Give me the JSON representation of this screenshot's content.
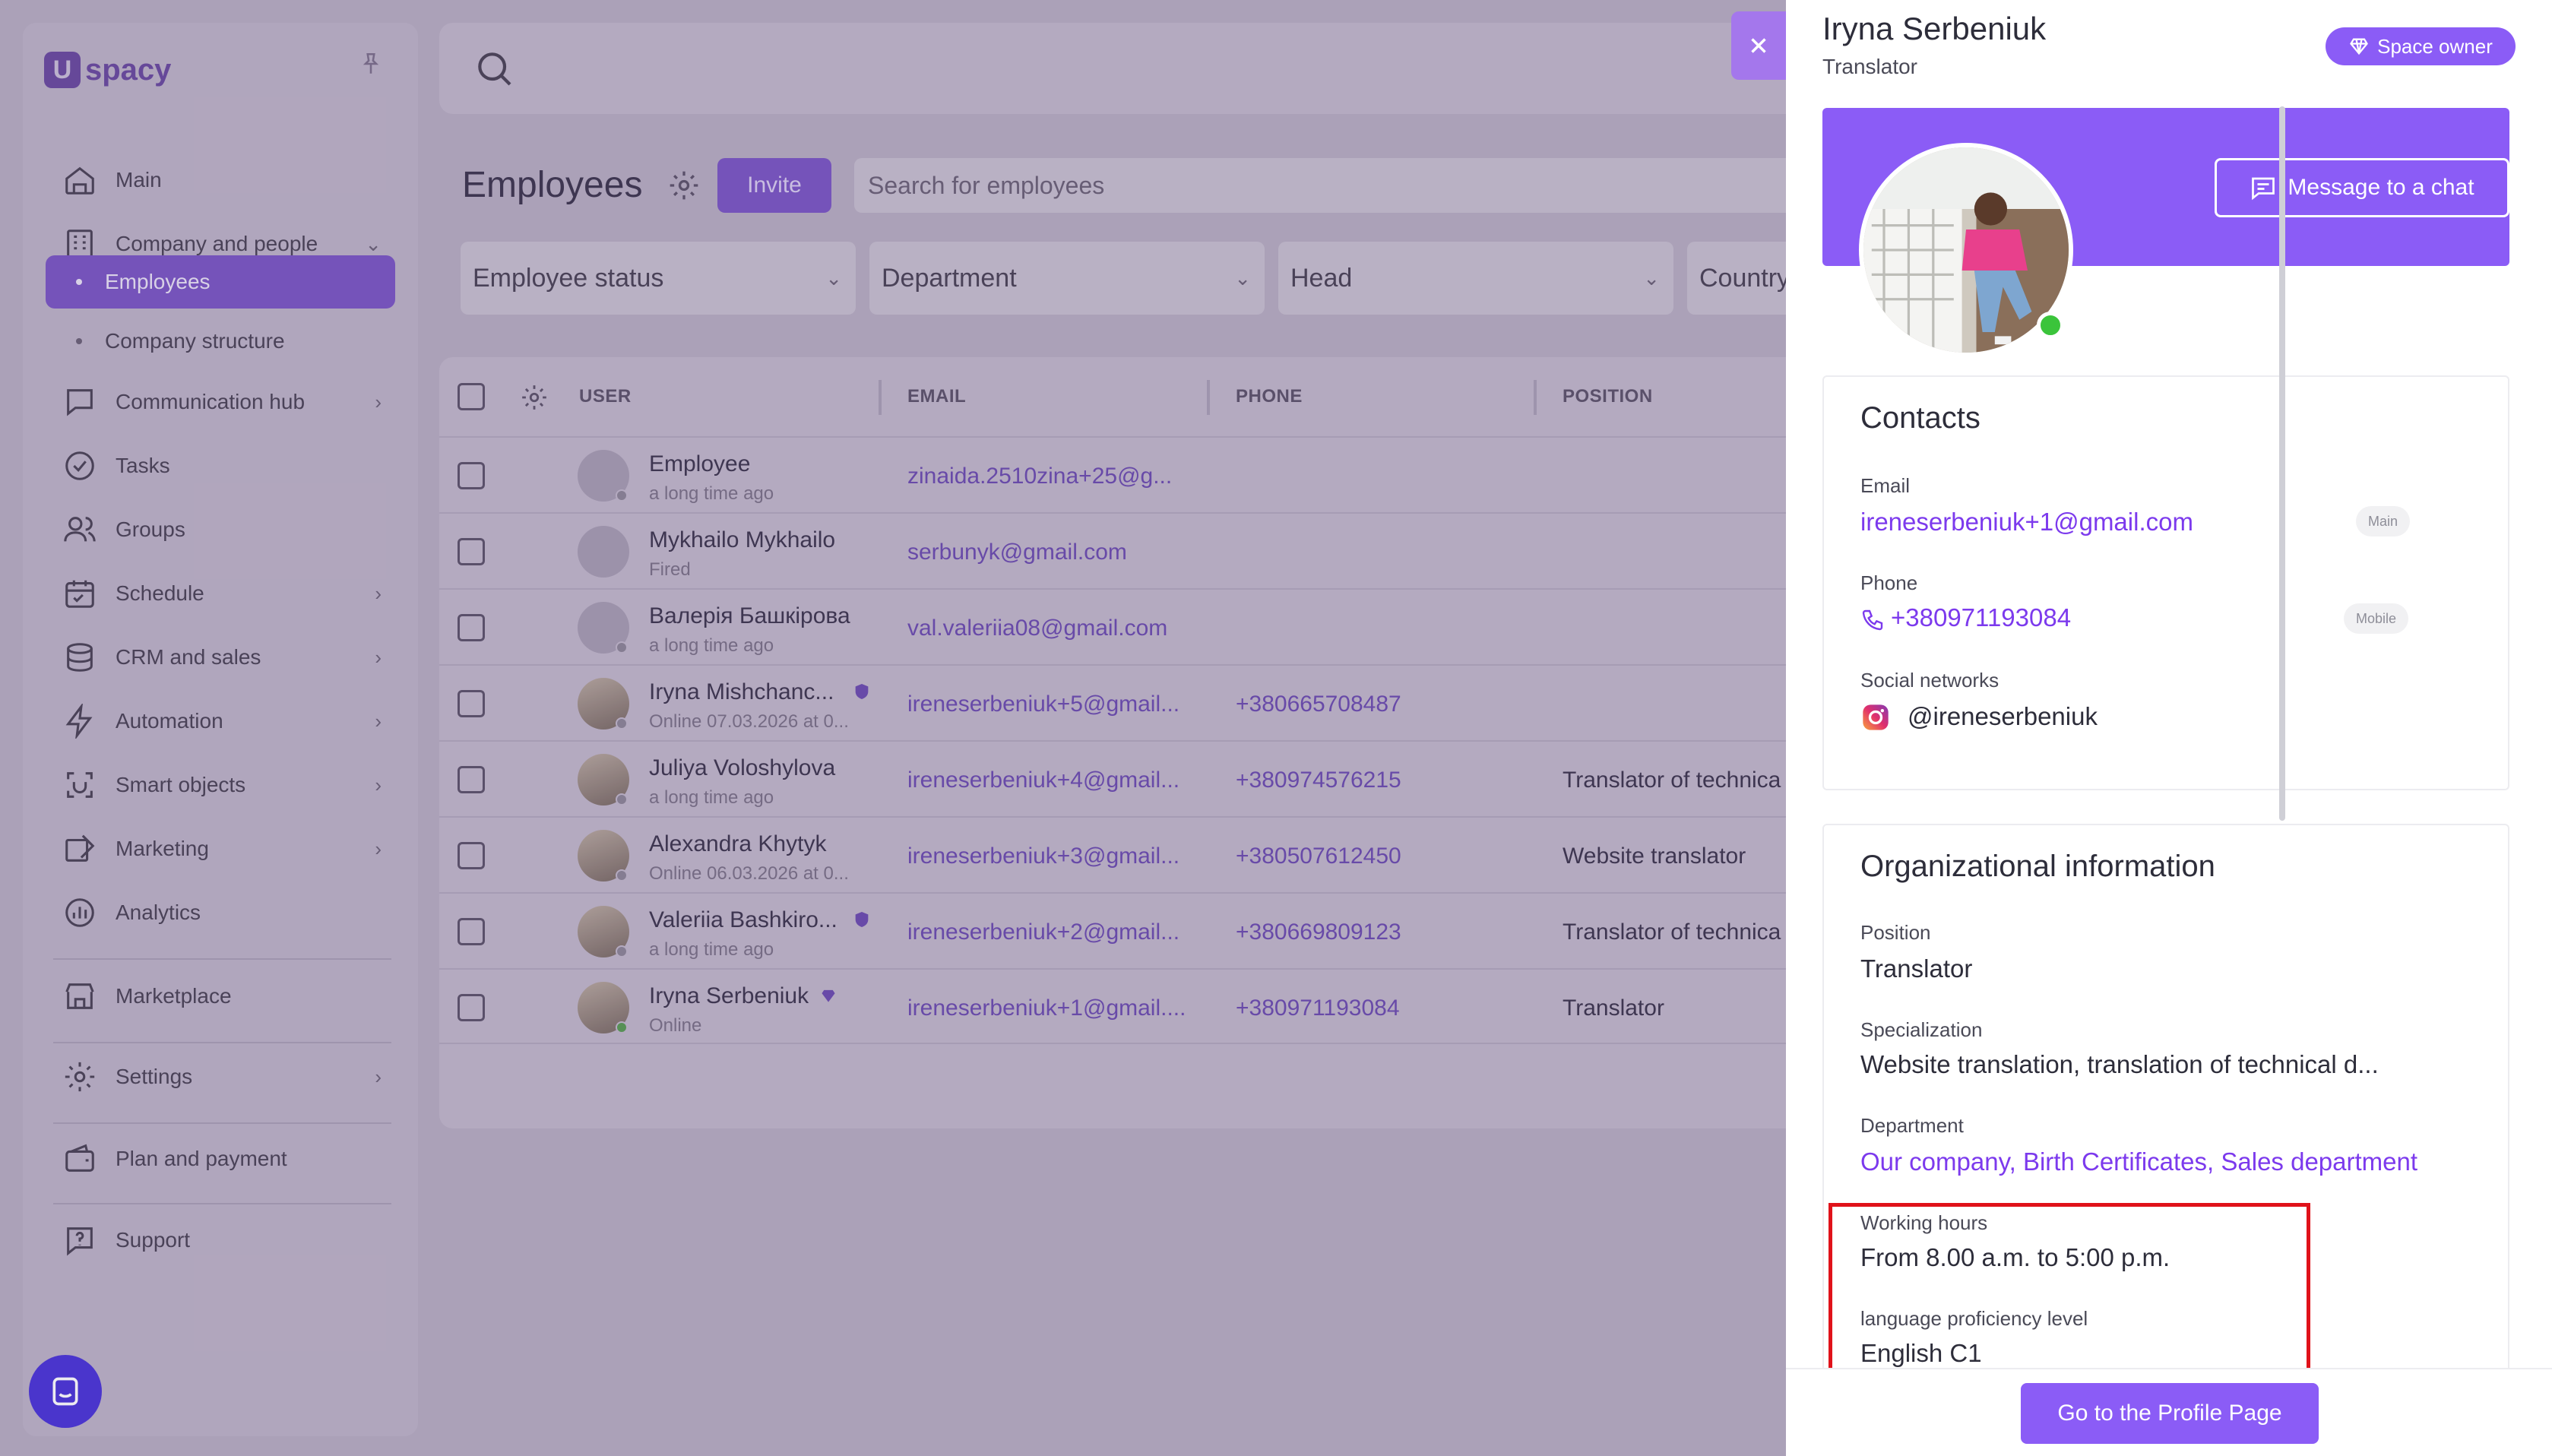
{
  "sidebar": {
    "logo_text": "spacy",
    "items": [
      {
        "label": "Main",
        "icon": "home-icon"
      },
      {
        "label": "Company and people",
        "icon": "company-icon"
      },
      {
        "label": "Employees"
      },
      {
        "label": "Company structure"
      },
      {
        "label": "Communication hub",
        "icon": "chat-icon"
      },
      {
        "label": "Tasks",
        "icon": "tasks-icon"
      },
      {
        "label": "Groups",
        "icon": "groups-icon"
      },
      {
        "label": "Schedule",
        "icon": "calendar-icon"
      },
      {
        "label": "CRM and sales",
        "icon": "crm-icon"
      },
      {
        "label": "Automation",
        "icon": "lightning-icon"
      },
      {
        "label": "Smart objects",
        "icon": "smart-objects-icon"
      },
      {
        "label": "Marketing",
        "icon": "marketing-icon"
      },
      {
        "label": "Analytics",
        "icon": "analytics-icon"
      },
      {
        "label": "Marketplace",
        "icon": "marketplace-icon"
      },
      {
        "label": "Settings",
        "icon": "settings-icon"
      },
      {
        "label": "Plan and payment",
        "icon": "wallet-icon"
      },
      {
        "label": "Support",
        "icon": "support-icon"
      }
    ]
  },
  "employees_page": {
    "title": "Employees",
    "invite_label": "Invite",
    "search_placeholder": "Search for employees",
    "filters": [
      "Employee status",
      "Department",
      "Head",
      "Country"
    ],
    "columns": [
      "USER",
      "EMAIL",
      "PHONE",
      "POSITION"
    ],
    "rows": [
      {
        "name": "Employee",
        "sub": "a long time ago",
        "email": "zinaida.2510zina+25@g...",
        "phone": "",
        "position": ""
      },
      {
        "name": "Mykhailo Mykhailo",
        "sub": "Fired",
        "email": "serbunyk@gmail.com",
        "phone": "",
        "position": ""
      },
      {
        "name": "Валерія Башкірова",
        "sub": "a long time ago",
        "email": "val.valeriia08@gmail.com",
        "phone": "",
        "position": ""
      },
      {
        "name": "Iryna Mishchanc...",
        "sub": "Online 07.03.2026 at 0...",
        "email": "ireneserbeniuk+5@gmail...",
        "phone": "+380665708487",
        "position": ""
      },
      {
        "name": "Juliya Voloshylova",
        "sub": "a long time ago",
        "email": "ireneserbeniuk+4@gmail...",
        "phone": "+380974576215",
        "position": "Translator of technica"
      },
      {
        "name": "Alexandra Khytyk",
        "sub": "Online 06.03.2026 at 0...",
        "email": "ireneserbeniuk+3@gmail...",
        "phone": "+380507612450",
        "position": "Website translator"
      },
      {
        "name": "Valeriia Bashkiro...",
        "sub": "a long time ago",
        "email": "ireneserbeniuk+2@gmail...",
        "phone": "+380669809123",
        "position": "Translator of technica"
      },
      {
        "name": "Iryna Serbeniuk",
        "sub": "Online",
        "email": "ireneserbeniuk+1@gmail....",
        "phone": "+380971193084",
        "position": "Translator"
      }
    ]
  },
  "profile_panel": {
    "name": "Iryna Serbeniuk",
    "role": "Translator",
    "owner_badge": "Space owner",
    "message_button": "Message to a chat",
    "contacts": {
      "title": "Contacts",
      "email_label": "Email",
      "email": "ireneserbeniuk+1@gmail.com",
      "email_tag": "Main",
      "phone_label": "Phone",
      "phone": "+380971193084",
      "phone_tag": "Mobile",
      "social_label": "Social networks",
      "social": "@ireneserbeniuk"
    },
    "org": {
      "title": "Organizational information",
      "position_label": "Position",
      "position": "Translator",
      "specialization_label": "Specialization",
      "specialization": "Website translation, translation of technical d...",
      "department_label": "Department",
      "department": "Our company, Birth Certificates, Sales department",
      "hours_label": "Working hours",
      "hours": "From 8.00 a.m. to 5:00 p.m.",
      "language_label": "language proficiency level",
      "language": "English C1"
    },
    "profile_button": "Go to the Profile Page"
  },
  "colors": {
    "accent": "#8b5cf6",
    "highlight": "#e0121a",
    "online": "#3bc43b"
  }
}
